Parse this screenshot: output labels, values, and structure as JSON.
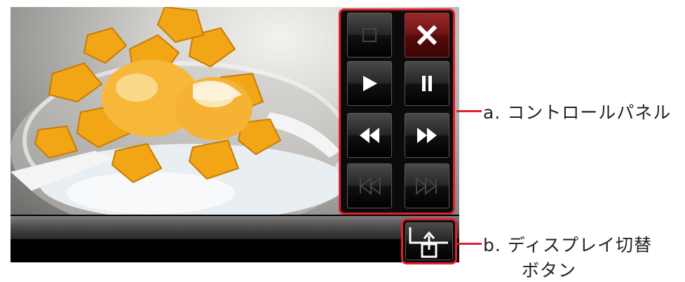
{
  "player": {
    "photo_description_icon": "shaved-ice-mango-photo",
    "controls": [
      {
        "name": "stop-button",
        "icon": "stop-icon",
        "enabled": false
      },
      {
        "name": "close-button",
        "icon": "close-icon",
        "enabled": true
      },
      {
        "name": "play-button",
        "icon": "play-icon",
        "enabled": true
      },
      {
        "name": "pause-button",
        "icon": "pause-icon",
        "enabled": true
      },
      {
        "name": "rewind-button",
        "icon": "rewind-icon",
        "enabled": true
      },
      {
        "name": "fast-forward-button",
        "icon": "fast-forward-icon",
        "enabled": true
      },
      {
        "name": "previous-track-button",
        "icon": "skip-previous-icon",
        "enabled": false
      },
      {
        "name": "next-track-button",
        "icon": "skip-next-icon",
        "enabled": false
      }
    ],
    "display_switch_icon": "display-switch-icon"
  },
  "callouts": {
    "a": "a.  コントロールパネル",
    "b_line1": "b.  ディスプレイ切替",
    "b_line2": "ボタン"
  },
  "colors": {
    "highlight": "#e0202e",
    "close_button": "#6e1414"
  }
}
